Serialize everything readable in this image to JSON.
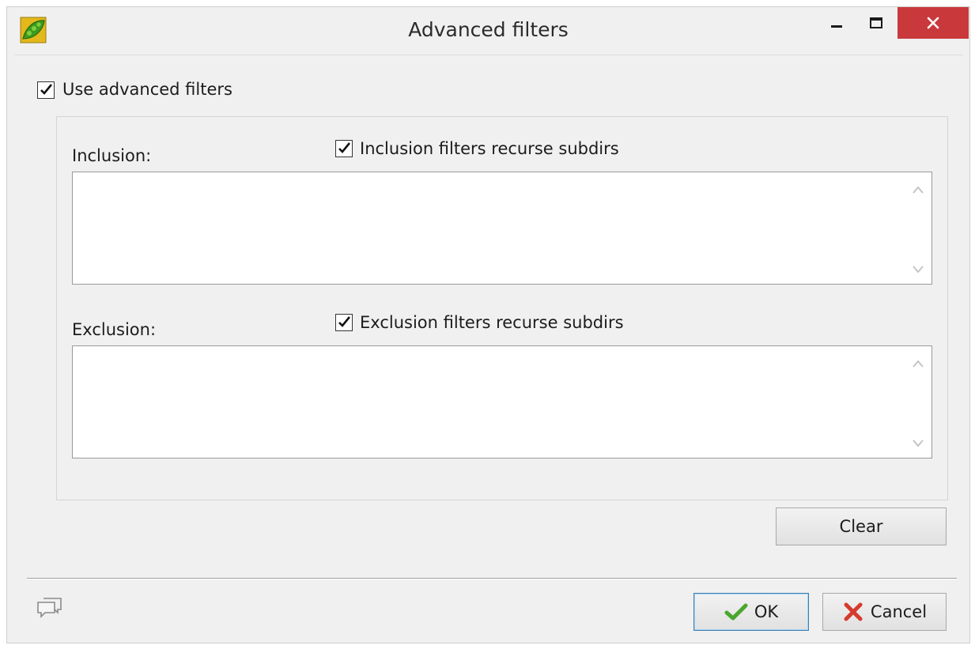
{
  "window": {
    "title": "Advanced filters"
  },
  "use_advanced": {
    "label": "Use advanced filters",
    "checked": true
  },
  "inclusion": {
    "label": "Inclusion:",
    "recurse_label": "Inclusion filters recurse subdirs",
    "recurse_checked": true,
    "value": ""
  },
  "exclusion": {
    "label": "Exclusion:",
    "recurse_label": "Exclusion filters recurse subdirs",
    "recurse_checked": true,
    "value": ""
  },
  "buttons": {
    "clear": "Clear",
    "ok": "OK",
    "cancel": "Cancel"
  },
  "icons": {
    "app": "pea-pod-icon",
    "comment": "speech-bubbles-icon",
    "ok": "green-check-icon",
    "cancel": "red-x-icon"
  },
  "colors": {
    "close_button": "#c9393b",
    "default_button_border": "#3c7fb1"
  }
}
